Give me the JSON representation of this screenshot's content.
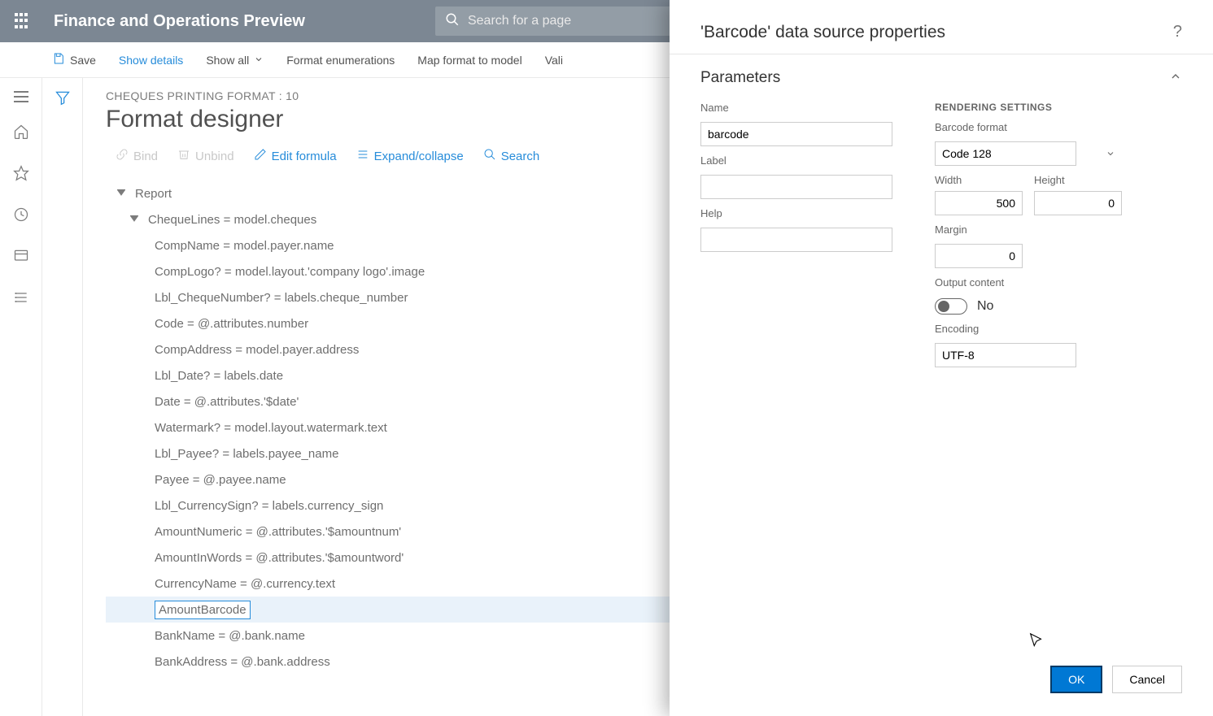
{
  "topbar": {
    "brand": "Finance and Operations Preview",
    "search_placeholder": "Search for a page"
  },
  "cmdbar": {
    "save": "Save",
    "show_details": "Show details",
    "show_all": "Show all",
    "format_enum": "Format enumerations",
    "map_format": "Map format to model",
    "validate": "Vali"
  },
  "page": {
    "breadcrumb": "CHEQUES PRINTING FORMAT : 10",
    "title": "Format designer"
  },
  "toolbar": {
    "bind": "Bind",
    "unbind": "Unbind",
    "edit_formula": "Edit formula",
    "expand": "Expand/collapse",
    "search": "Search"
  },
  "tree": {
    "root": "Report",
    "chequelines": "ChequeLines = model.cheques",
    "items": [
      "CompName = model.payer.name",
      "CompLogo? = model.layout.'company logo'.image",
      "Lbl_ChequeNumber? = labels.cheque_number",
      "Code = @.attributes.number",
      "CompAddress = model.payer.address",
      "Lbl_Date? = labels.date",
      "Date = @.attributes.'$date'",
      "Watermark? = model.layout.watermark.text",
      "Lbl_Payee? = labels.payee_name",
      "Payee = @.payee.name",
      "Lbl_CurrencySign? = labels.currency_sign",
      "AmountNumeric = @.attributes.'$amountnum'",
      "AmountInWords = @.attributes.'$amountword'",
      "CurrencyName = @.currency.text"
    ],
    "selected": "AmountBarcode",
    "rest": [
      "BankName = @.bank.name",
      "BankAddress = @.bank.address"
    ]
  },
  "panel": {
    "title": "'Barcode' data source properties",
    "section": "Parameters",
    "left": {
      "name_label": "Name",
      "name_value": "barcode",
      "label_label": "Label",
      "label_value": "",
      "help_label": "Help",
      "help_value": ""
    },
    "right": {
      "heading": "RENDERING SETTINGS",
      "format_label": "Barcode format",
      "format_value": "Code 128",
      "width_label": "Width",
      "width_value": "500",
      "height_label": "Height",
      "height_value": "0",
      "margin_label": "Margin",
      "margin_value": "0",
      "output_label": "Output content",
      "output_value": "No",
      "encoding_label": "Encoding",
      "encoding_value": "UTF-8"
    },
    "buttons": {
      "ok": "OK",
      "cancel": "Cancel"
    }
  }
}
